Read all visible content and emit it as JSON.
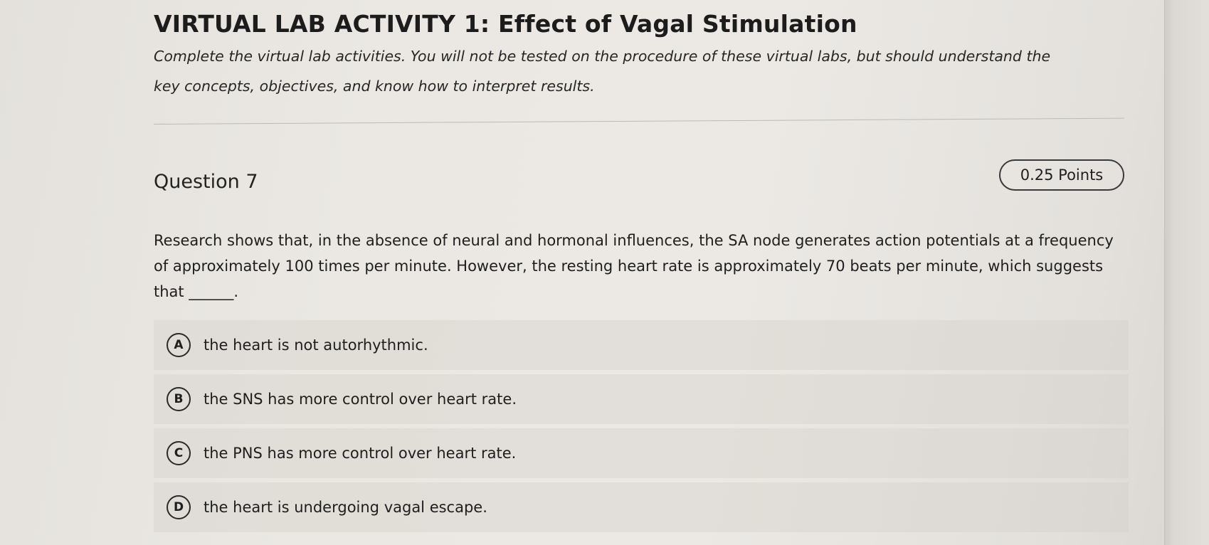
{
  "header": {
    "title": "VIRTUAL LAB ACTIVITY 1: Effect of Vagal Stimulation",
    "instructions": "Complete the virtual lab activities. You will not be tested on the procedure of these virtual labs, but should understand the key concepts, objectives, and know how to interpret results."
  },
  "question": {
    "heading": "Question 7",
    "points": "0.25 Points",
    "prompt": "Research shows that, in the absence of neural and hormonal influences, the SA node generates action potentials at a frequency of approximately 100 times per minute. However, the resting heart rate is approximately 70 beats per minute, which suggests that ______.",
    "options": [
      {
        "letter": "A",
        "text": "the heart is not autorhythmic."
      },
      {
        "letter": "B",
        "text": "the SNS has more control over heart rate."
      },
      {
        "letter": "C",
        "text": "the PNS has more control over heart rate."
      },
      {
        "letter": "D",
        "text": "the heart is undergoing vagal escape."
      }
    ]
  }
}
